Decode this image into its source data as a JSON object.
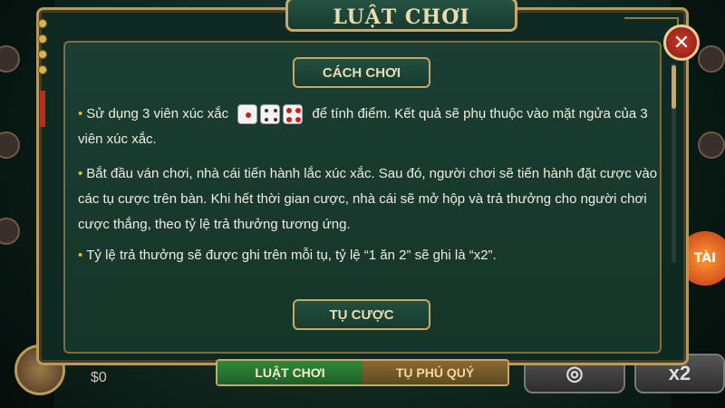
{
  "dialog": {
    "title": "LUẬT CHƠI",
    "close_label": "✕"
  },
  "sections": [
    {
      "heading": "CÁCH CHƠI"
    },
    {
      "heading": "TỤ CƯỢC"
    }
  ],
  "paragraphs": {
    "p1_before": "Sử dụng 3 viên xúc xắc",
    "p1_after": "để tính điểm. Kết quả sẽ phụ thuộc vào mặt ngửa của 3 viên xúc xắc.",
    "p2": "Bắt đầu ván chơi, nhà cái tiến hành lắc xúc xắc. Sau đó, người chơi sẽ tiến hành đặt cược vào các tụ cược trên bàn. Khi hết thời gian cược, nhà cái sẽ mở hộp và trả thưởng cho người chơi cược thắng, theo tỷ lệ trả thưởng tương ứng.",
    "p3": "Tỷ lệ trả thưởng sẽ được ghi trên mỗi tụ, tỷ lệ “1 ăn 2” sẽ ghi là “x2”."
  },
  "bottom_tabs": [
    {
      "label": "LUẬT CHƠI",
      "active": true
    },
    {
      "label": "TỤ PHÚ QUÝ",
      "active": false
    }
  ],
  "player": {
    "balance": "$0"
  },
  "bet_buttons": {
    "x2_label": "x2"
  },
  "side_seats": {
    "left": [],
    "right": []
  },
  "badge": {
    "label": "TÀI"
  },
  "colors": {
    "accent_gold": "#c7a866",
    "panel_green": "#163529",
    "tab_active": "#2f8a3a",
    "close_red": "#c9372a"
  },
  "icons": [
    "close-icon",
    "dice-icon",
    "bullet-icon"
  ]
}
